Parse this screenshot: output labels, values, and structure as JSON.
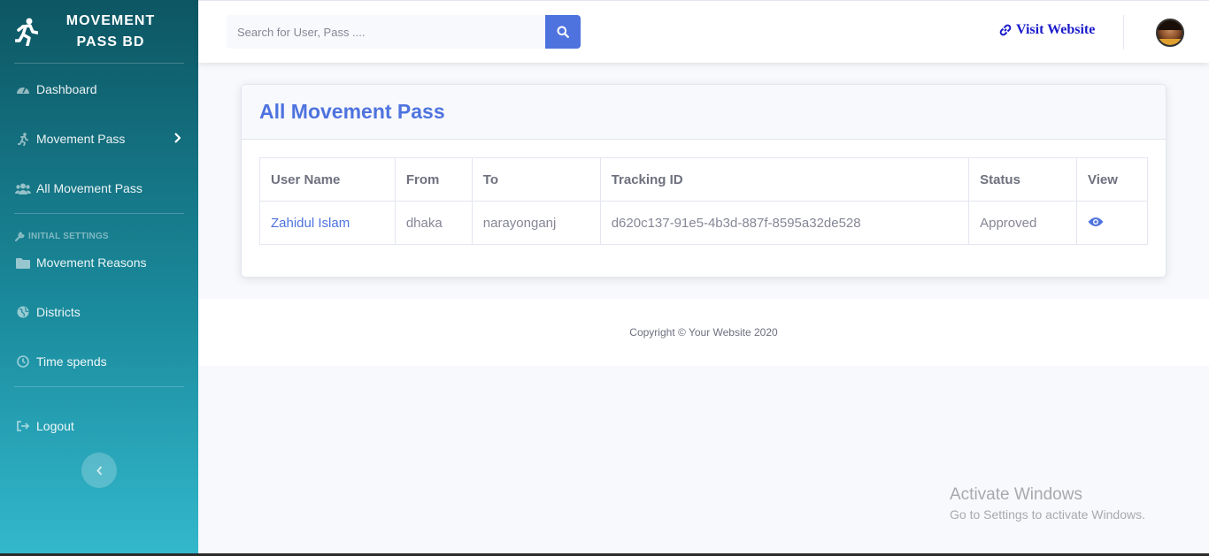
{
  "sidebar": {
    "brand": "Movement Pass BD",
    "items": [
      {
        "label": "Dashboard",
        "icon": "tachometer-icon"
      },
      {
        "label": "Movement Pass",
        "icon": "running-icon"
      },
      {
        "label": "All Movement Pass",
        "icon": "users-icon"
      }
    ],
    "section_heading": "INITIAL SETTINGS",
    "settings_items": [
      {
        "label": "Movement Reasons",
        "icon": "folder-icon"
      },
      {
        "label": "Districts",
        "icon": "globe-icon"
      },
      {
        "label": "Time spends",
        "icon": "clock-icon"
      }
    ],
    "logout_label": "Logout"
  },
  "topbar": {
    "search_placeholder": "Search for User, Pass ....",
    "visit_label": "Visit Website"
  },
  "card": {
    "title": "All Movement Pass",
    "columns": [
      "User Name",
      "From",
      "To",
      "Tracking ID",
      "Status",
      "View"
    ],
    "rows": [
      {
        "user_name": "Zahidul Islam",
        "from": "dhaka",
        "to": "narayonganj",
        "tracking_id": "d620c137-91e5-4b3d-887f-8595a32de528",
        "status": "Approved"
      }
    ]
  },
  "footer": {
    "copyright": "Copyright © Your Website 2020"
  },
  "watermark": {
    "line1": "Activate Windows",
    "line2": "Go to Settings to activate Windows."
  },
  "colors": {
    "primary": "#4e73df",
    "sidebar_top": "#0d5663",
    "sidebar_bottom": "#33b8cc",
    "visit_link": "#1a1acc"
  }
}
